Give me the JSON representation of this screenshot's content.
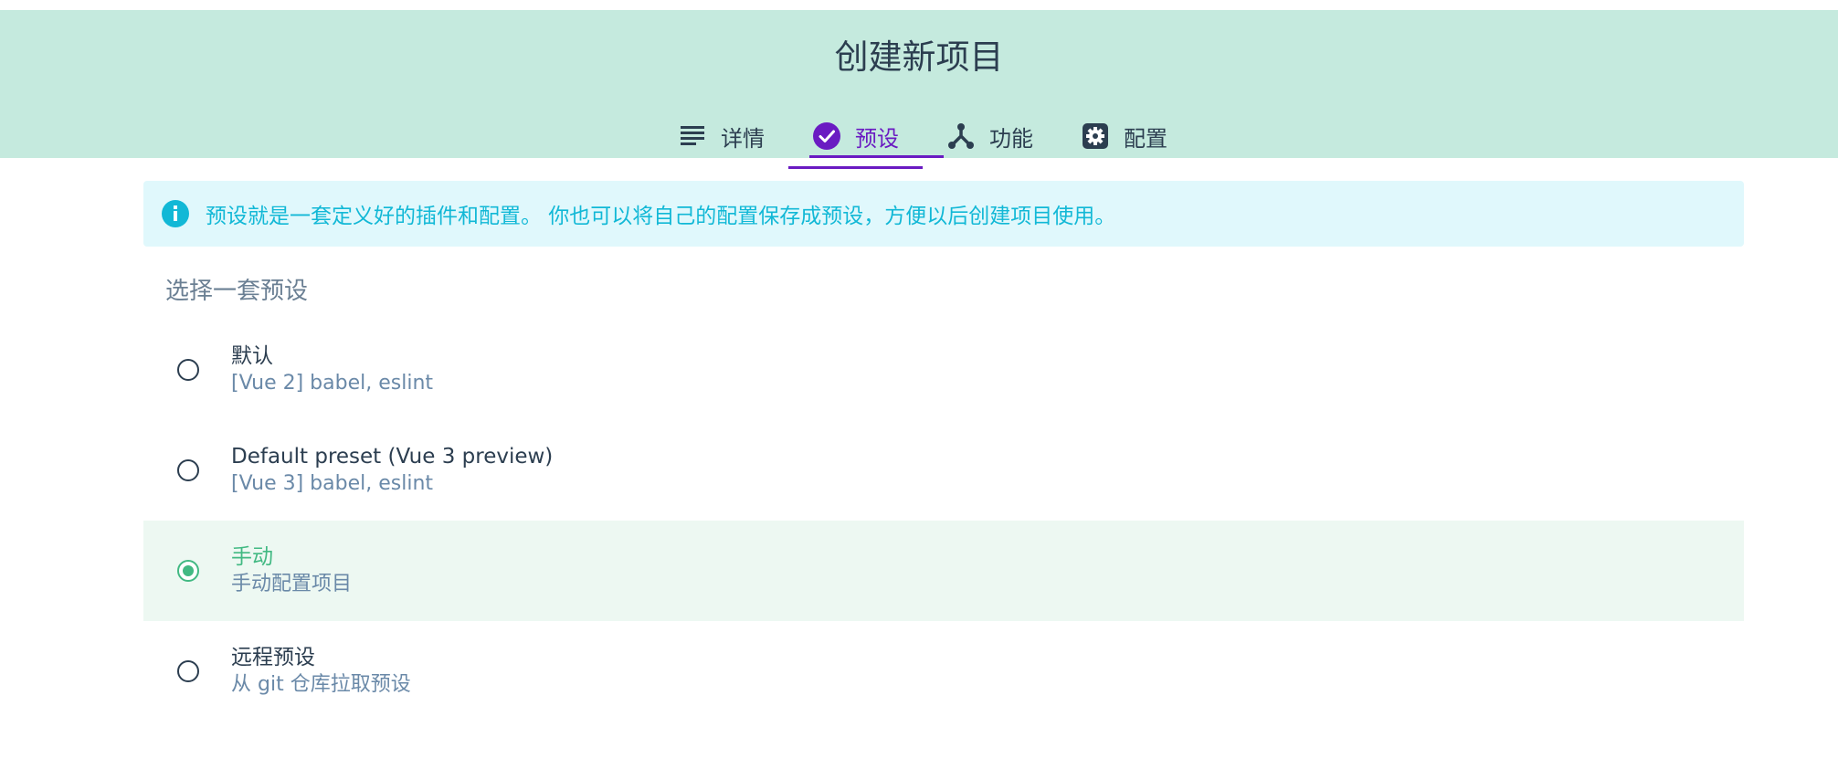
{
  "header": {
    "title": "创建新项目",
    "tabs": [
      {
        "label": "详情",
        "icon": "list-icon"
      },
      {
        "label": "预设",
        "icon": "check-circle-icon",
        "active": true
      },
      {
        "label": "功能",
        "icon": "fork-icon"
      },
      {
        "label": "配置",
        "icon": "gear-icon"
      }
    ]
  },
  "info": {
    "text": "预设就是一套定义好的插件和配置。 你也可以将自己的配置保存成预设，方便以后创建项目使用。",
    "icon": "info-icon"
  },
  "presets": {
    "title": "选择一套预设",
    "items": [
      {
        "name": "默认",
        "desc": "[Vue 2] babel, eslint",
        "selected": false
      },
      {
        "name": "Default preset (Vue 3 preview)",
        "desc": "[Vue 3] babel, eslint",
        "selected": false
      },
      {
        "name": "手动",
        "desc": "手动配置项目",
        "selected": true
      },
      {
        "name": "远程预设",
        "desc": "从 git 仓库拉取预设",
        "selected": false
      }
    ]
  },
  "colors": {
    "header_bg": "#c5eade",
    "accent": "#6a1bc2",
    "selected": "#42b983",
    "info": "#12b8d6",
    "text": "#2c3e50"
  }
}
